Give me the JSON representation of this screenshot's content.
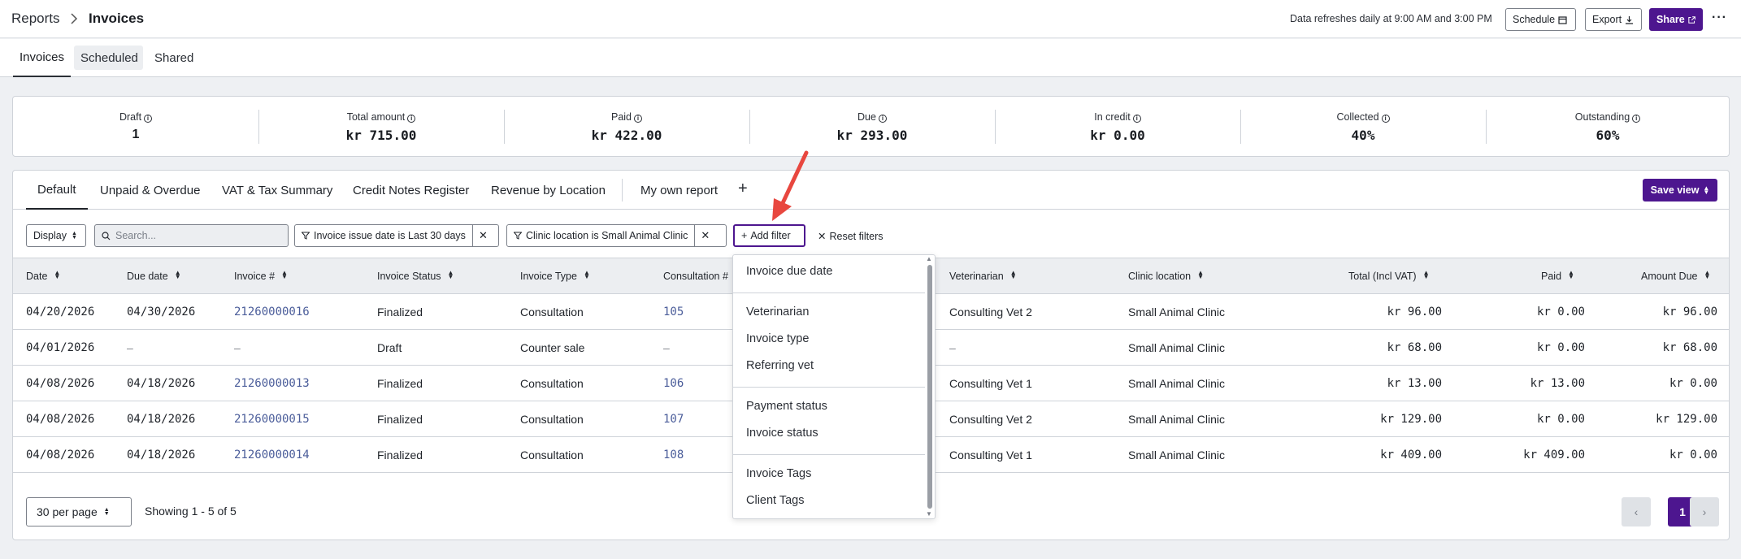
{
  "header": {
    "breadcrumb_root": "Reports",
    "breadcrumb_current": "Invoices",
    "refresh_note": "Data refreshes daily at 9:00 AM and 3:00 PM",
    "schedule_label": "Schedule",
    "export_label": "Export",
    "share_label": "Share",
    "more_label": "···"
  },
  "tabs": [
    {
      "label": "Invoices"
    },
    {
      "label": "Scheduled"
    },
    {
      "label": "Shared"
    }
  ],
  "summary": [
    {
      "label": "Draft",
      "value": "1"
    },
    {
      "label": "Total amount",
      "value": "kr 715.00"
    },
    {
      "label": "Paid",
      "value": "kr 422.00"
    },
    {
      "label": "Due",
      "value": "kr 293.00"
    },
    {
      "label": "In credit",
      "value": "kr 0.00"
    },
    {
      "label": "Collected",
      "value": "40%"
    },
    {
      "label": "Outstanding",
      "value": "60%"
    }
  ],
  "views": {
    "items": [
      "Default",
      "Unpaid & Overdue",
      "VAT & Tax Summary",
      "Credit Notes Register",
      "Revenue by Location",
      "My own report"
    ],
    "add": "+",
    "save_label": "Save view"
  },
  "filters": {
    "display_label": "Display",
    "search_placeholder": "Search...",
    "chip1": "Invoice issue date is Last 30 days",
    "chip2": "Clinic location is Small Animal Clinic",
    "add_filter": "Add filter",
    "reset_filters": "Reset filters"
  },
  "table": {
    "columns": [
      "Date",
      "Due date",
      "Invoice #",
      "Invoice Status",
      "Invoice Type",
      "Consultation #",
      "Veterinarian",
      "Clinic location",
      "Total (Incl VAT)",
      "Paid",
      "Amount Due"
    ],
    "rows": [
      [
        "04/20/2026",
        "04/30/2026",
        "21260000016",
        "Finalized",
        "Consultation",
        "105",
        "Consulting Vet 2",
        "Small Animal Clinic",
        "kr 96.00",
        "kr 0.00",
        "kr 96.00"
      ],
      [
        "04/01/2026",
        "–",
        "–",
        "Draft",
        "Counter sale",
        "–",
        "–",
        "Small Animal Clinic",
        "kr 68.00",
        "kr 0.00",
        "kr 68.00"
      ],
      [
        "04/08/2026",
        "04/18/2026",
        "21260000013",
        "Finalized",
        "Consultation",
        "106",
        "Consulting Vet 1",
        "Small Animal Clinic",
        "kr 13.00",
        "kr 13.00",
        "kr 0.00"
      ],
      [
        "04/08/2026",
        "04/18/2026",
        "21260000015",
        "Finalized",
        "Consultation",
        "107",
        "Consulting Vet 2",
        "Small Animal Clinic",
        "kr 129.00",
        "kr 0.00",
        "kr 129.00"
      ],
      [
        "04/08/2026",
        "04/18/2026",
        "21260000014",
        "Finalized",
        "Consultation",
        "108",
        "Consulting Vet 1",
        "Small Animal Clinic",
        "kr 409.00",
        "kr 409.00",
        "kr 0.00"
      ]
    ]
  },
  "footer": {
    "per_page": "30 per page",
    "showing": "Showing 1 - 5 of 5",
    "page": "1",
    "prev": "‹",
    "next": "›"
  },
  "dropdown": {
    "items": [
      "Invoice due date",
      "Veterinarian",
      "Invoice type",
      "Referring vet",
      "Payment status",
      "Invoice status",
      "Invoice Tags",
      "Client Tags"
    ]
  },
  "colors": {
    "brand": "#4d168f",
    "link": "#4b5d9a",
    "annotation": "#e8473f"
  }
}
